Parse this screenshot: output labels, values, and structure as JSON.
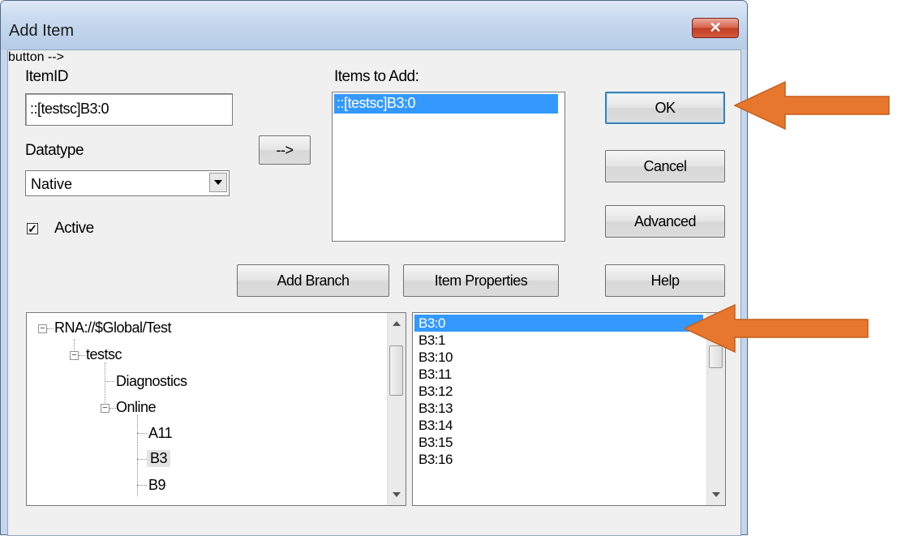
{
  "window": {
    "title": "Add Item",
    "close_glyph": "✕"
  },
  "item_id": {
    "label": "ItemID",
    "value": "::[testsc]B3:0"
  },
  "datatype": {
    "label": "Datatype",
    "value": "Native"
  },
  "active": {
    "label": "Active",
    "checked": true,
    "check_glyph": "✓"
  },
  "move_button": {
    "label": "-->"
  },
  "items_to_add": {
    "label": "Items to Add:",
    "items": [
      "::[testsc]B3:0"
    ]
  },
  "buttons": {
    "ok": "OK",
    "cancel": "Cancel",
    "advanced": "Advanced",
    "help": "Help",
    "add_branch": "Add Branch",
    "item_properties": "Item Properties"
  },
  "tree": {
    "root": "RNA://$Global/Test",
    "testsc": "testsc",
    "diagnostics": "Diagnostics",
    "online": "Online",
    "a11": "A11",
    "b3": "B3",
    "b9": "B9",
    "expand_glyph": "−"
  },
  "item_list": [
    "B3:0",
    "B3:1",
    "B3:10",
    "B3:11",
    "B3:12",
    "B3:13",
    "B3:14",
    "B3:15",
    "B3:16"
  ],
  "colors": {
    "selection": "#3399ff",
    "annotation_arrow": "#e8772e"
  }
}
